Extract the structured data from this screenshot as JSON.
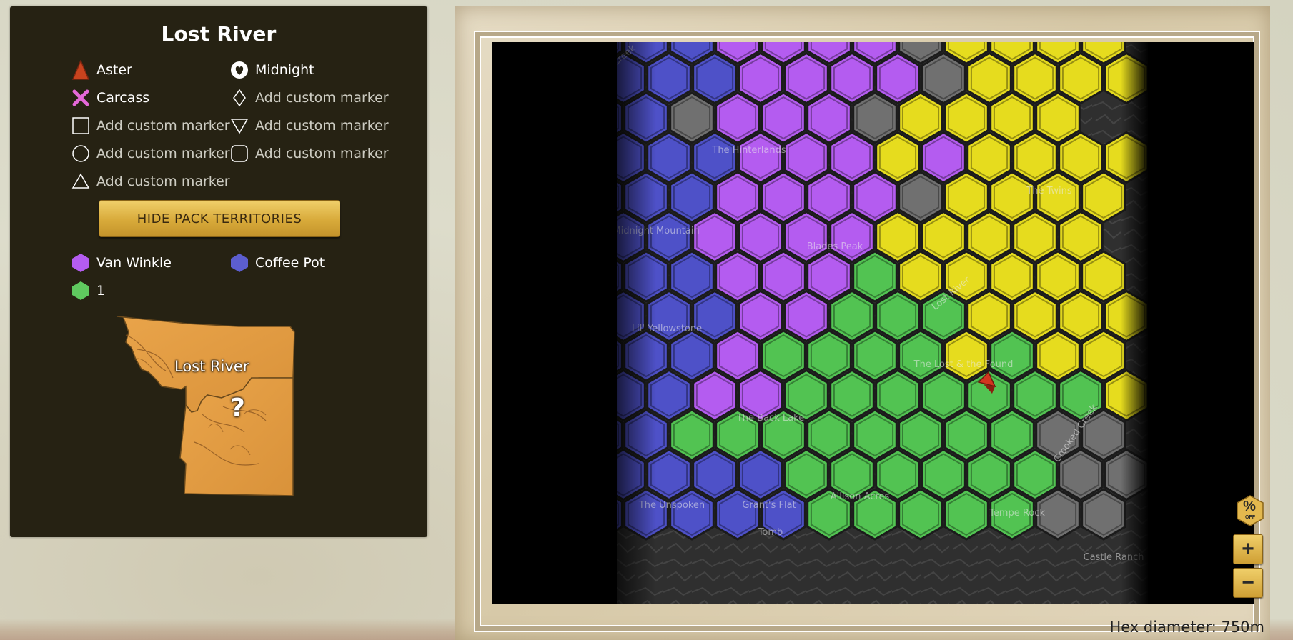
{
  "panel": {
    "title": "Lost River",
    "markers": [
      {
        "label": "Aster",
        "icon": "aster-marker-icon",
        "type": "named"
      },
      {
        "label": "Midnight",
        "icon": "midnight-marker-icon",
        "type": "named"
      },
      {
        "label": "Carcass",
        "icon": "carcass-marker-icon",
        "type": "named"
      },
      {
        "label": "Add custom marker",
        "icon": "diamond-marker-icon",
        "type": "custom"
      },
      {
        "label": "Add custom marker",
        "icon": "square-marker-icon",
        "type": "custom"
      },
      {
        "label": "Add custom marker",
        "icon": "triangle-down-marker-icon",
        "type": "custom"
      },
      {
        "label": "Add custom marker",
        "icon": "circle-marker-icon",
        "type": "custom"
      },
      {
        "label": "Add custom marker",
        "icon": "rounded-square-marker-icon",
        "type": "custom"
      },
      {
        "label": "Add custom marker",
        "icon": "triangle-up-marker-icon",
        "type": "custom"
      }
    ],
    "toggle_button": "HIDE PACK TERRITORIES",
    "packs": [
      {
        "name": "Van Winkle",
        "color": "#b45cf0"
      },
      {
        "name": "Coffee Pot",
        "color": "#5c5ecf"
      },
      {
        "name": "1",
        "color": "#5fc95f"
      }
    ],
    "mini_map": {
      "label": "Lost River",
      "unknown": "?"
    }
  },
  "map": {
    "labels": [
      "Grant's Creek",
      "The Hinterlands",
      "Midnight Mountain",
      "Blades Peak",
      "The Twins",
      "Lil' Yellowstone",
      "Lost River",
      "The Lost & the Found",
      "The Back Lake",
      "Crooked Creek",
      "The Unspoken",
      "Grant's Flat",
      "Allison Acres",
      "Tempe Rock",
      "Tomb",
      "Castle Ranch"
    ],
    "hex_info": "Hex diameter: 750m",
    "controls": {
      "percent_label": "%",
      "percent_sub": "OFF",
      "zoom_in": "+",
      "zoom_out": "−"
    },
    "colors": {
      "purple": "#b45cf0",
      "blue": "#4e51c8",
      "yellow": "#e6dc1e",
      "green": "#52c352",
      "gray": "#707070"
    }
  }
}
